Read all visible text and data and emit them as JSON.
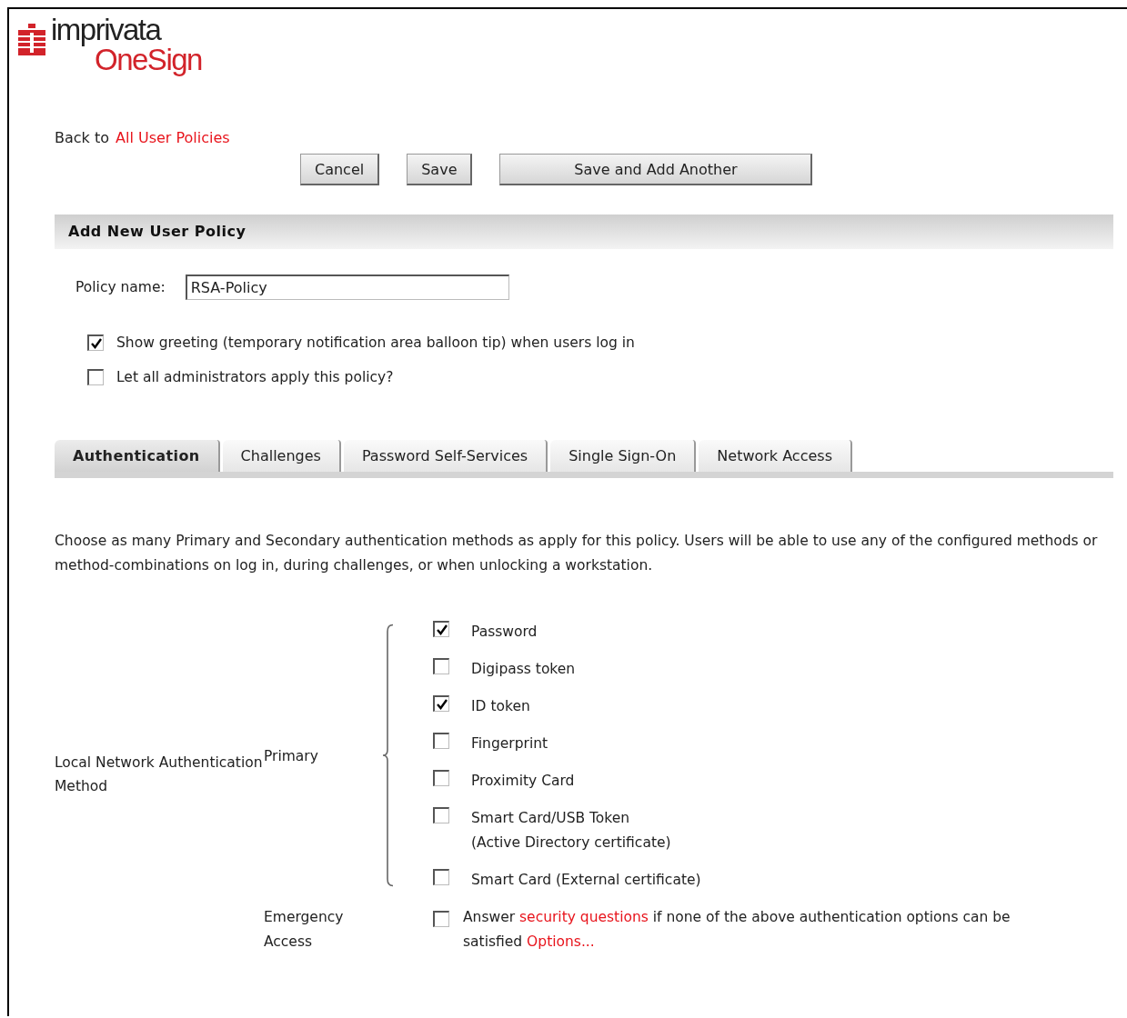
{
  "logo": {
    "name": "imprivata",
    "product": "OneSign"
  },
  "back": {
    "prefix": "Back to",
    "link": "All User Policies"
  },
  "buttons": [
    "Cancel",
    "Save",
    "Save and Add Another"
  ],
  "section_title": "Add New User Policy",
  "policy_name": {
    "label": "Policy name:",
    "value": "RSA-Policy"
  },
  "options": [
    {
      "label": "Show greeting (temporary notification area balloon tip) when users log in",
      "checked": true
    },
    {
      "label": "Let all administrators apply this policy?",
      "checked": false
    }
  ],
  "tabs": [
    {
      "label": "Authentication",
      "selected": true
    },
    {
      "label": "Challenges",
      "selected": false
    },
    {
      "label": "Password Self-Services",
      "selected": false
    },
    {
      "label": "Single Sign-On",
      "selected": false
    },
    {
      "label": "Network Access",
      "selected": false
    }
  ],
  "intro": "Choose as many Primary and Secondary authentication methods as apply for this policy. Users will be able to use any of the configured methods or method-combinations on log in, during challenges, or when unlocking a workstation.",
  "group_label": "Local Network Authentication Method",
  "primary": {
    "label": "Primary",
    "methods": [
      {
        "label": "Password",
        "checked": true
      },
      {
        "label": "Digipass token",
        "checked": false
      },
      {
        "label": "ID token",
        "checked": true
      },
      {
        "label": "Fingerprint",
        "checked": false
      },
      {
        "label": "Proximity Card",
        "checked": false
      },
      {
        "label": "Smart Card/USB Token",
        "note": "(Active Directory certificate)",
        "checked": false
      },
      {
        "label": "Smart Card (External certificate)",
        "checked": false
      }
    ]
  },
  "emergency": {
    "label": "Emergency Access",
    "checked": false,
    "sentence": [
      {
        "kind": "text",
        "text": "Answer "
      },
      {
        "kind": "link",
        "text": "security questions"
      },
      {
        "kind": "text",
        "text": " if none of the above authentication options can be satisfied "
      },
      {
        "kind": "link",
        "text": "Options..."
      }
    ]
  }
}
